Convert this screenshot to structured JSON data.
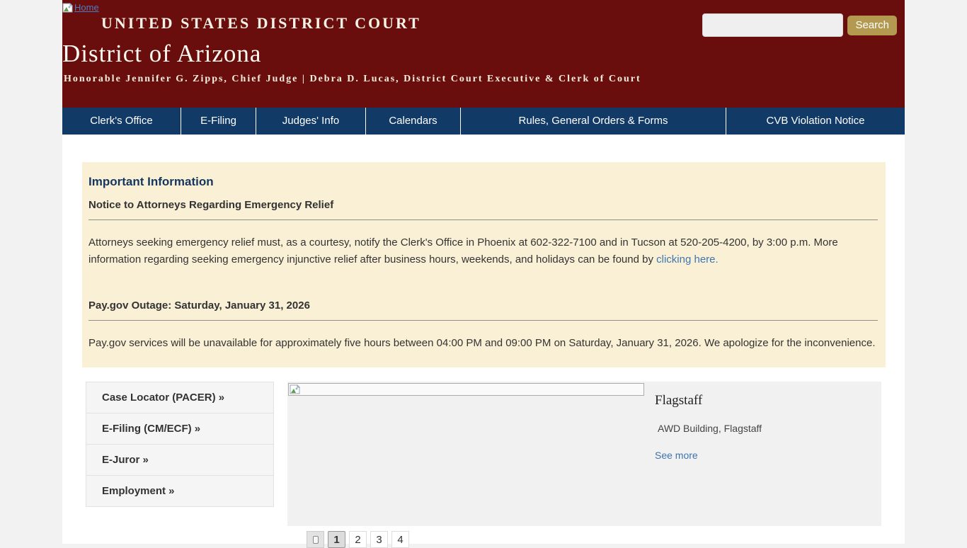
{
  "header": {
    "home_link_label": "Home",
    "court_title": "UNITED STATES DISTRICT COURT",
    "district_title": "District of Arizona",
    "subtitle": "Honorable Jennifer G. Zipps, Chief Judge | Debra D. Lucas, District Court Executive & Clerk of Court",
    "search_value": "",
    "search_button_label": "Search"
  },
  "nav": {
    "items": [
      {
        "label": "Clerk's Office"
      },
      {
        "label": "E-Filing"
      },
      {
        "label": "Judges' Info"
      },
      {
        "label": "Calendars"
      },
      {
        "label": "Rules, General Orders & Forms"
      },
      {
        "label": "CVB Violation Notice"
      }
    ]
  },
  "notice_box": {
    "title": "Important Information",
    "section1": {
      "heading": "Notice to Attorneys Regarding Emergency Relief",
      "body_before_link": "Attorneys seeking emergency relief must, as a courtesy, notify the Clerk's Office in Phoenix at 602-322-7100 and in Tucson at 520-205-4200, by 3:00 p.m. More information regarding seeking emergency injunctive relief after business hours, weekends, and holidays can be found by ",
      "link_text": "clicking here."
    },
    "section2": {
      "heading": "Pay.gov Outage: Saturday, January 31, 2026",
      "body": "Pay.gov services will be unavailable for approximately five hours between 04:00 PM and 09:00 PM on Saturday, January 31, 2026. We apologize for the inconvenience."
    }
  },
  "quick_links": [
    {
      "label": "Case Locator (PACER) »"
    },
    {
      "label": "E-Filing (CM/ECF) »"
    },
    {
      "label": "E-Juror »"
    },
    {
      "label": "Employment »"
    }
  ],
  "carousel": {
    "slide_title": "Flagstaff",
    "slide_caption": "AWD Building, Flagstaff",
    "see_more_label": "See more",
    "pages": {
      "p1": "1",
      "p2": "2",
      "p3": "3",
      "p4": "4"
    },
    "active_page": "1"
  },
  "colors": {
    "header_maroon": "#6a0d0d",
    "nav_navy": "#123a66",
    "notice_cream": "#faf0d5",
    "notice_title_navy": "#15365f",
    "search_button_tan": "#b49a51",
    "link_blue": "#3e76b4"
  }
}
